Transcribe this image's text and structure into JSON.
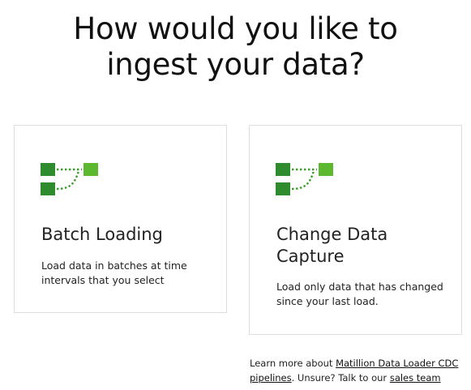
{
  "header": {
    "title_line1": "How would you like to",
    "title_line2": "ingest your data?"
  },
  "colors": {
    "icon_dark_green": "#2e8b2e",
    "icon_light_green": "#5cb82e",
    "card_border": "#dedede"
  },
  "cards": [
    {
      "icon": "pipeline-icon",
      "title": "Batch Loading",
      "description": "Load data in batches at time intervals that you select"
    },
    {
      "icon": "pipeline-icon",
      "title": "Change Data Capture",
      "description": "Load only data that has changed since your last load."
    }
  ],
  "footer": {
    "prefix": "Learn more about ",
    "link1": "Matillion Data Loader CDC pipelines",
    "middle": ". Unsure? Talk to our ",
    "link2": "sales team"
  }
}
